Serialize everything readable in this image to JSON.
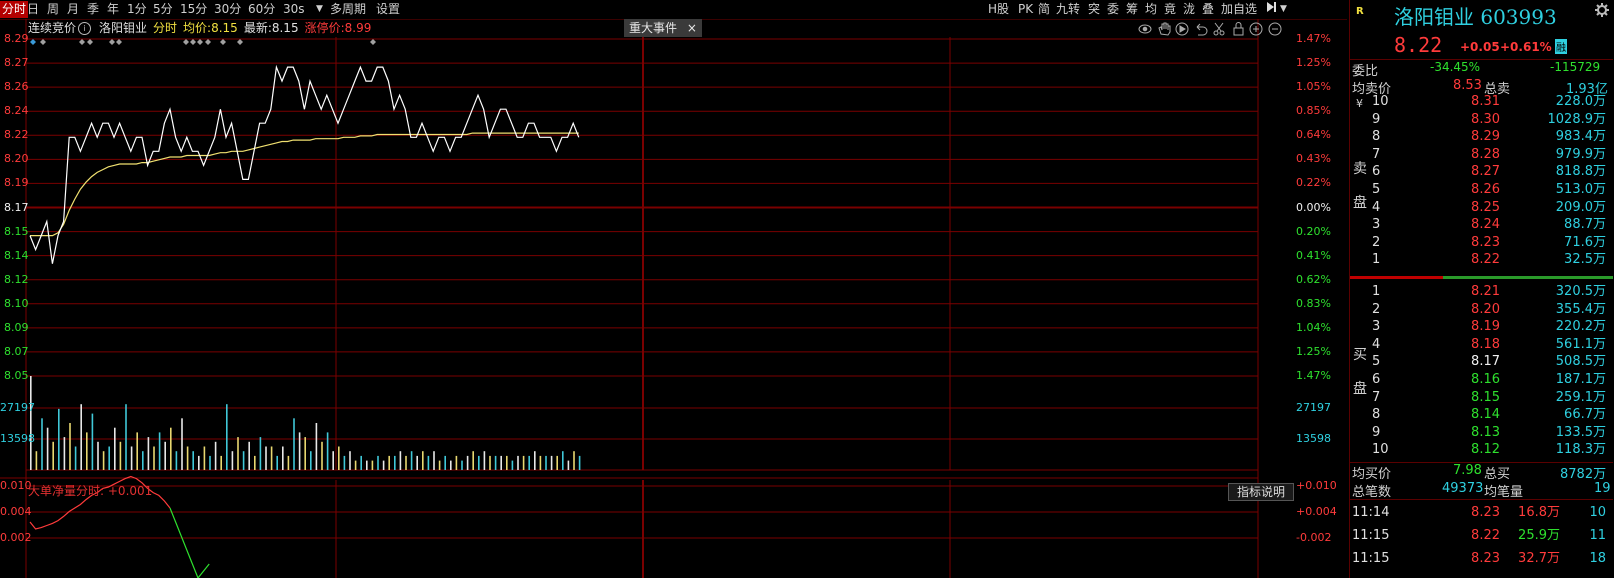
{
  "toolbar": {
    "items": [
      "分时",
      "日",
      "周",
      "月",
      "季",
      "年",
      "1分",
      "5分",
      "15分",
      "30分",
      "60分",
      "30s",
      "多周期",
      "设置"
    ],
    "dropdown_arrow": "▼",
    "right_items": [
      "H股",
      "PK",
      "简",
      "九转",
      "突",
      "委",
      "筹",
      "均",
      "竟",
      "泷",
      "叠",
      "加自选"
    ],
    "right_icon": "play-arrow-icon"
  },
  "infoline": {
    "label": "连续竞价",
    "name": "洛阳钼业",
    "mode": "分时",
    "avg_label": "均价:",
    "avg_value": "8.15",
    "last_label": "最新:",
    "last_value": "8.15",
    "limit_label": "涨停价:",
    "limit_value": "8.99"
  },
  "event_tab": {
    "label": "重大事件",
    "close": "×"
  },
  "chart_icons": [
    "eye-icon",
    "hand-icon",
    "play-icon",
    "undo-icon",
    "scissors-icon",
    "lock-icon",
    "zoom-in-icon",
    "zoom-out-icon"
  ],
  "chart_data": [
    {
      "type": "line",
      "title": "",
      "ylim": [
        8.05,
        8.29
      ],
      "prev_close": 8.17,
      "y_ticks_left": [
        "8.29",
        "8.27",
        "8.26",
        "8.24",
        "8.22",
        "8.20",
        "8.19",
        "8.17",
        "8.15",
        "8.14",
        "8.12",
        "8.10",
        "8.09",
        "8.07",
        "8.05"
      ],
      "y_ticks_right": [
        "1.47%",
        "1.25%",
        "1.05%",
        "0.85%",
        "0.64%",
        "0.43%",
        "0.22%",
        "0.00%",
        "0.20%",
        "0.41%",
        "0.62%",
        "0.83%",
        "1.04%",
        "1.25%",
        "1.47%"
      ],
      "series": [
        {
          "values": [
            8.15,
            8.14,
            8.15,
            8.16,
            8.13,
            8.15,
            8.16,
            8.22,
            8.22,
            8.21,
            8.22,
            8.23,
            8.22,
            8.23,
            8.23,
            8.22,
            8.23,
            8.22,
            8.21,
            8.22,
            8.22,
            8.2,
            8.21,
            8.21,
            8.23,
            8.24,
            8.22,
            8.21,
            8.22,
            8.21,
            8.21,
            8.2,
            8.21,
            8.22,
            8.24,
            8.22,
            8.23,
            8.21,
            8.19,
            8.19,
            8.21,
            8.23,
            8.23,
            8.24,
            8.27,
            8.26,
            8.27,
            8.27,
            8.26,
            8.24,
            8.26,
            8.25,
            8.24,
            8.25,
            8.24,
            8.23,
            8.24,
            8.25,
            8.26,
            8.27,
            8.26,
            8.26,
            8.27,
            8.27,
            8.26,
            8.24,
            8.25,
            8.24,
            8.22,
            8.22,
            8.23,
            8.22,
            8.21,
            8.22,
            8.22,
            8.21,
            8.22,
            8.22,
            8.23,
            8.24,
            8.25,
            8.24,
            8.22,
            8.23,
            8.24,
            8.24,
            8.23,
            8.22,
            8.22,
            8.23,
            8.23,
            8.22,
            8.22,
            8.22,
            8.21,
            8.22,
            8.22,
            8.23,
            8.22
          ]
        },
        {
          "values": [
            8.15,
            8.15,
            8.15,
            8.15,
            8.15,
            8.152,
            8.158,
            8.168,
            8.176,
            8.183,
            8.188,
            8.192,
            8.195,
            8.197,
            8.199,
            8.2,
            8.201,
            8.201,
            8.201,
            8.201,
            8.202,
            8.202,
            8.203,
            8.204,
            8.205,
            8.206,
            8.206,
            8.206,
            8.207,
            8.207,
            8.207,
            8.207,
            8.207,
            8.208,
            8.209,
            8.209,
            8.21,
            8.21,
            8.21,
            8.211,
            8.212,
            8.213,
            8.214,
            8.215,
            8.216,
            8.217,
            8.217,
            8.218,
            8.218,
            8.218,
            8.218,
            8.219,
            8.219,
            8.219,
            8.219,
            8.219,
            8.22,
            8.22,
            8.22,
            8.221,
            8.221,
            8.221,
            8.222,
            8.222,
            8.222,
            8.222,
            8.222,
            8.222,
            8.222,
            8.222,
            8.222,
            8.222,
            8.222,
            8.222,
            8.222,
            8.222,
            8.222,
            8.222,
            8.222,
            8.223,
            8.223,
            8.223,
            8.223,
            8.223,
            8.223,
            8.223,
            8.223,
            8.223,
            8.223,
            8.223,
            8.223,
            8.223,
            8.223,
            8.223,
            8.223,
            8.223,
            8.223,
            8.223,
            8.223
          ]
        }
      ]
    },
    {
      "type": "bar",
      "y_ticks": [
        "27197",
        "13598"
      ],
      "ylim": [
        0,
        40000
      ],
      "values": [
        40000,
        8000,
        22000,
        18000,
        12000,
        26000,
        14000,
        20000,
        10000,
        28000,
        16000,
        24000,
        12000,
        8000,
        10000,
        18000,
        12000,
        28000,
        10000,
        16000,
        8000,
        14000,
        10000,
        16000,
        12000,
        18000,
        8000,
        22000,
        10000,
        8000,
        6000,
        10000,
        6000,
        12000,
        6000,
        28000,
        8000,
        14000,
        8000,
        12000,
        6000,
        14000,
        10000,
        10000,
        6000,
        10000,
        6000,
        22000,
        16000,
        14000,
        8000,
        20000,
        12000,
        16000,
        8000,
        10000,
        6000,
        8000,
        4000,
        6000,
        4000,
        4000,
        6000,
        4000,
        6000,
        6000,
        8000,
        6000,
        8000,
        6000,
        8000,
        6000,
        8000,
        4000,
        6000,
        4000,
        6000,
        4000,
        6000,
        8000,
        6000,
        8000,
        6000,
        6000,
        6000,
        6000,
        4000,
        6000,
        6000,
        6000,
        8000,
        6000,
        6000,
        6000,
        6000,
        8000,
        4000,
        8000,
        6000
      ]
    },
    {
      "type": "line",
      "title": "大单净量分时: +0.001",
      "ylim": [
        -0.004,
        0.01
      ],
      "y_ticks_left": [
        "0.010",
        "0.004",
        "0.002"
      ],
      "y_ticks_right": [
        "+0.010",
        "+0.004",
        "-0.002"
      ],
      "values": [
        0.004,
        0.003,
        0.0032,
        0.0035,
        0.0038,
        0.0042,
        0.0048,
        0.0055,
        0.006,
        0.0065,
        0.0072,
        0.0078,
        0.0082,
        0.0088,
        0.009,
        0.0094,
        0.0098,
        0.0102,
        0.0105,
        0.0102,
        0.0096,
        0.0088,
        0.0082,
        0.0078,
        0.007,
        0.006,
        0.004,
        0.002,
        0.0,
        -0.002,
        -0.004,
        -0.003,
        -0.002
      ]
    }
  ],
  "sub_panel": {
    "title": "大单净量分时:",
    "value": "+0.001",
    "indicator_button": "指标说明"
  },
  "stock": {
    "badge": "R",
    "name": "洛阳钼业",
    "code": "603993",
    "price": "8.22",
    "change": "+0.05",
    "change_pct": "+0.61%",
    "market_tag": "融"
  },
  "summary": {
    "weibi_label": "委比",
    "weibi_value": "-34.45%",
    "weicha_value": "-115729",
    "avg_sell_label": "均卖价",
    "avg_sell_value": "8.53",
    "total_sell_label": "总卖",
    "total_sell_value": "1.93亿",
    "avg_buy_label": "均买价",
    "avg_buy_value": "7.98",
    "total_buy_label": "总买",
    "total_buy_value": "8782万",
    "total_trades_label": "总笔数",
    "total_trades_value": "49373",
    "avg_trade_label": "均笔量",
    "avg_trade_value": "19"
  },
  "sell_label": [
    "卖",
    "盘"
  ],
  "buy_label": [
    "买",
    "盘"
  ],
  "currency_mark": "¥",
  "asks": [
    {
      "level": "10",
      "price": "8.31",
      "vol": "228.0万",
      "color": "red"
    },
    {
      "level": "9",
      "price": "8.30",
      "vol": "1028.9万",
      "color": "red"
    },
    {
      "level": "8",
      "price": "8.29",
      "vol": "983.4万",
      "color": "red"
    },
    {
      "level": "7",
      "price": "8.28",
      "vol": "979.9万",
      "color": "red"
    },
    {
      "level": "6",
      "price": "8.27",
      "vol": "818.8万",
      "color": "red"
    },
    {
      "level": "5",
      "price": "8.26",
      "vol": "513.0万",
      "color": "red"
    },
    {
      "level": "4",
      "price": "8.25",
      "vol": "209.0万",
      "color": "red"
    },
    {
      "level": "3",
      "price": "8.24",
      "vol": "88.7万",
      "color": "red"
    },
    {
      "level": "2",
      "price": "8.23",
      "vol": "71.6万",
      "color": "red"
    },
    {
      "level": "1",
      "price": "8.22",
      "vol": "32.5万",
      "color": "red"
    }
  ],
  "bids": [
    {
      "level": "1",
      "price": "8.21",
      "vol": "320.5万",
      "color": "red"
    },
    {
      "level": "2",
      "price": "8.20",
      "vol": "355.4万",
      "color": "red"
    },
    {
      "level": "3",
      "price": "8.19",
      "vol": "220.2万",
      "color": "red"
    },
    {
      "level": "4",
      "price": "8.18",
      "vol": "561.1万",
      "color": "red"
    },
    {
      "level": "5",
      "price": "8.17",
      "vol": "508.5万",
      "color": "white"
    },
    {
      "level": "6",
      "price": "8.16",
      "vol": "187.1万",
      "color": "green"
    },
    {
      "level": "7",
      "price": "8.15",
      "vol": "259.1万",
      "color": "green"
    },
    {
      "level": "8",
      "price": "8.14",
      "vol": "66.7万",
      "color": "green"
    },
    {
      "level": "9",
      "price": "8.13",
      "vol": "133.5万",
      "color": "green"
    },
    {
      "level": "10",
      "price": "8.12",
      "vol": "118.3万",
      "color": "green"
    }
  ],
  "trades": [
    {
      "time": "11:14",
      "price": "8.23",
      "vol": "16.8万",
      "count": "10",
      "vol_color": "red"
    },
    {
      "time": "11:15",
      "price": "8.22",
      "vol": "25.9万",
      "count": "11",
      "vol_color": "green"
    },
    {
      "time": "11:15",
      "price": "8.23",
      "vol": "32.7万",
      "count": "18",
      "vol_color": "red"
    }
  ],
  "colors": {
    "up": "#ff3b3b",
    "down": "#2ee02e",
    "grid": "#7a0000",
    "price_line": "#ffffff",
    "avg_line": "#f0e070",
    "cyan": "#2fd0e0",
    "bar_yellow": "#e8d870",
    "bar_cyan": "#40c8d8",
    "bar_white": "#e8e8e8"
  }
}
